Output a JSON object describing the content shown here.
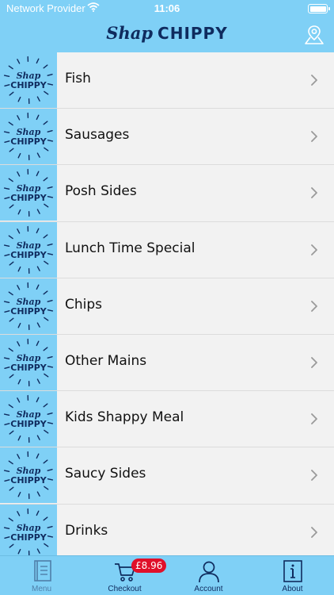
{
  "status_bar": {
    "carrier": "Network Provider",
    "time": "11:06"
  },
  "header": {
    "brand_script": "Shap",
    "brand_word": "CHIPPY"
  },
  "menu": {
    "thumbnail_text": {
      "script": "Shap",
      "word": "CHIPPY"
    },
    "items": [
      {
        "label": "Fish"
      },
      {
        "label": "Sausages"
      },
      {
        "label": "Posh Sides"
      },
      {
        "label": "Lunch Time Special"
      },
      {
        "label": "Chips"
      },
      {
        "label": "Other Mains"
      },
      {
        "label": "Kids Shappy Meal"
      },
      {
        "label": "Saucy Sides"
      },
      {
        "label": "Drinks"
      }
    ]
  },
  "tabbar": {
    "tabs": [
      {
        "label": "Menu",
        "icon": "menu-book-icon"
      },
      {
        "label": "Checkout",
        "icon": "cart-icon"
      },
      {
        "label": "Account",
        "icon": "account-icon"
      },
      {
        "label": "About",
        "icon": "info-icon"
      }
    ],
    "cart_total": "£8.96"
  },
  "colors": {
    "header_bg": "#7fd0f6",
    "brand_navy": "#0f2b5e",
    "badge_red": "#e0102a"
  }
}
